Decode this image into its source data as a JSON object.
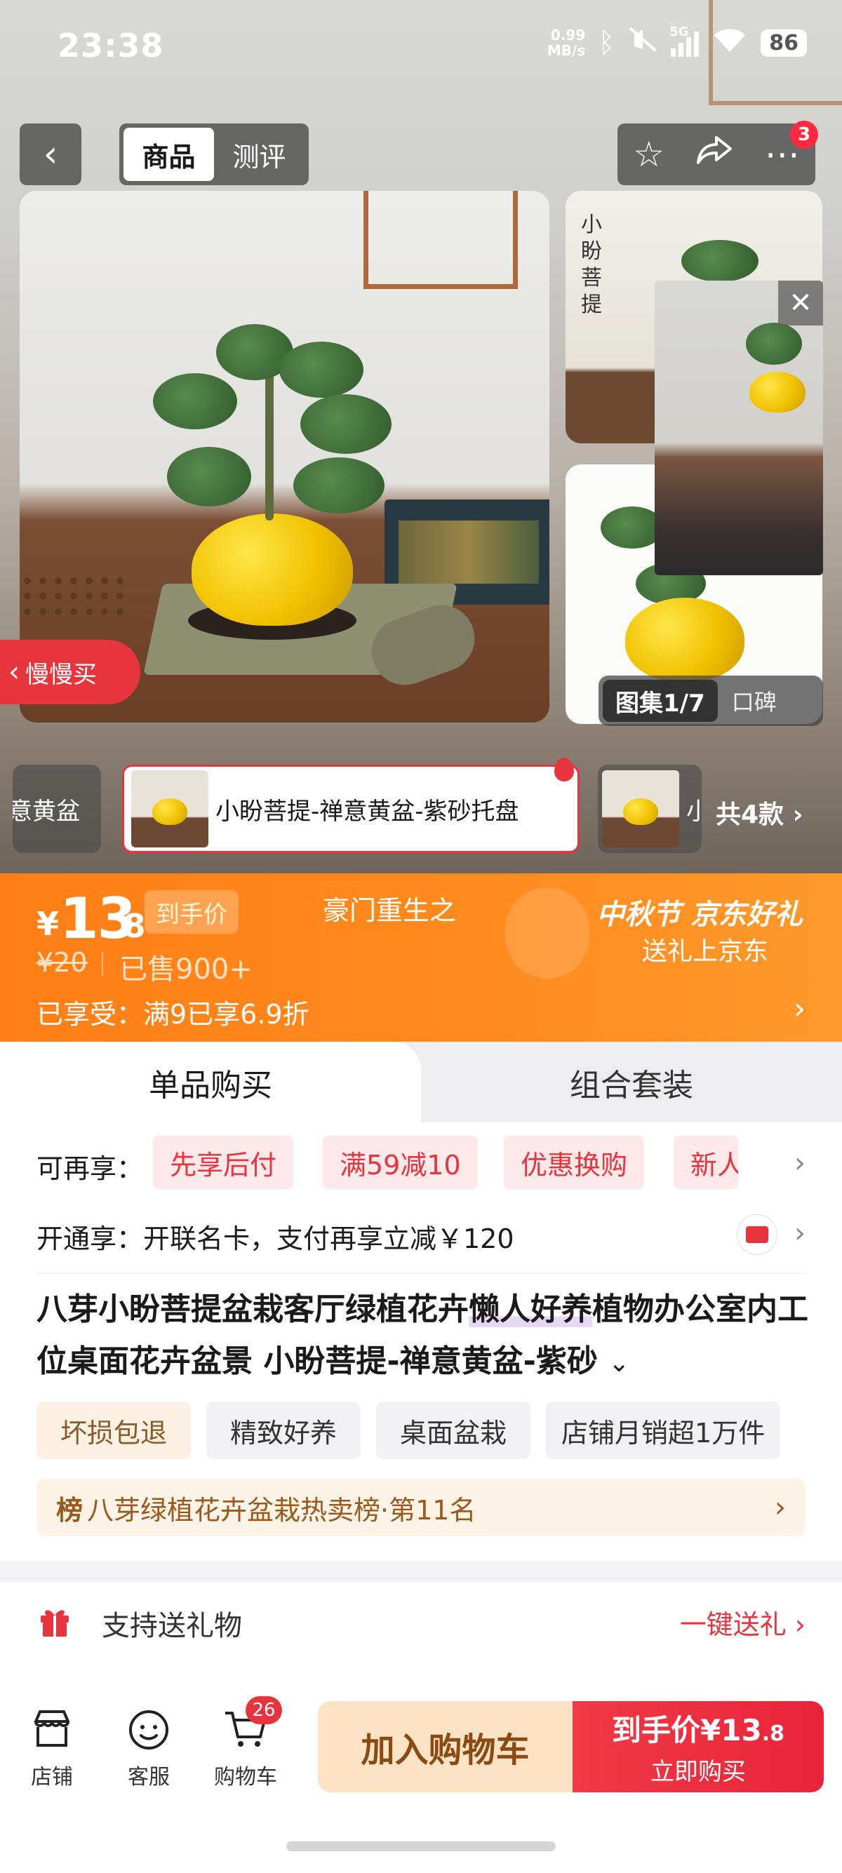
{
  "status": {
    "time": "23:38",
    "net_speed_value": "0.99",
    "net_speed_unit": "MB/s",
    "battery": "86",
    "network": "5G"
  },
  "header": {
    "tabs": [
      {
        "label": "商品"
      },
      {
        "label": "测评"
      }
    ],
    "action_badge": "3"
  },
  "media": {
    "thumb_vertical_text": "小盼菩提",
    "gallery_label": "图集1/7",
    "reviews_label": "口碑",
    "slow_buy": "慢慢买"
  },
  "variants": {
    "items": [
      {
        "label": "意黄盆"
      },
      {
        "label": "小盼菩提-禅意黄盆-紫砂托盘"
      },
      {
        "label": "小"
      }
    ],
    "count_label": "共4款"
  },
  "price": {
    "currency": "¥",
    "integer": "13",
    "decimal": ".8",
    "tag": "到手价",
    "center_text": "豪门重生之",
    "original": "¥20",
    "sold": "已售900+",
    "enjoyed": "已享受：满9已享6.9折",
    "festival_title": "中秋节 京东好礼",
    "festival_sub": "送礼上京东"
  },
  "buy_tabs": [
    {
      "label": "单品购买"
    },
    {
      "label": "组合套装"
    }
  ],
  "promos": {
    "label": "可再享：",
    "items": [
      "先享后付",
      "满59减10",
      "优惠换购",
      "新人三"
    ]
  },
  "membership": {
    "text": "开通享：开联名卡，支付再享立减￥120"
  },
  "product": {
    "title_part1": "八芽小盼菩提盆栽客厅绿植花卉",
    "title_highlight": "懒人好养",
    "title_part2": "植物办公室内工位桌面花卉盆景 小盼菩提-禅意黄盆-紫砂"
  },
  "tags": [
    "坏损包退",
    "精致好养",
    "桌面盆栽",
    "店铺月销超1万件"
  ],
  "ranking": {
    "badge": "榜",
    "text": "八芽绿植花卉盆栽热卖榜·第11名"
  },
  "gift": {
    "label": "支持送礼物",
    "action": "一键送礼"
  },
  "bottom": {
    "nav": [
      {
        "label": "店铺"
      },
      {
        "label": "客服"
      },
      {
        "label": "购物车"
      }
    ],
    "cart_count": "26",
    "add_to_cart": "加入购物车",
    "buy_price_prefix": "到手价¥13",
    "buy_price_decimal": ".8",
    "buy_now": "立即购买"
  }
}
